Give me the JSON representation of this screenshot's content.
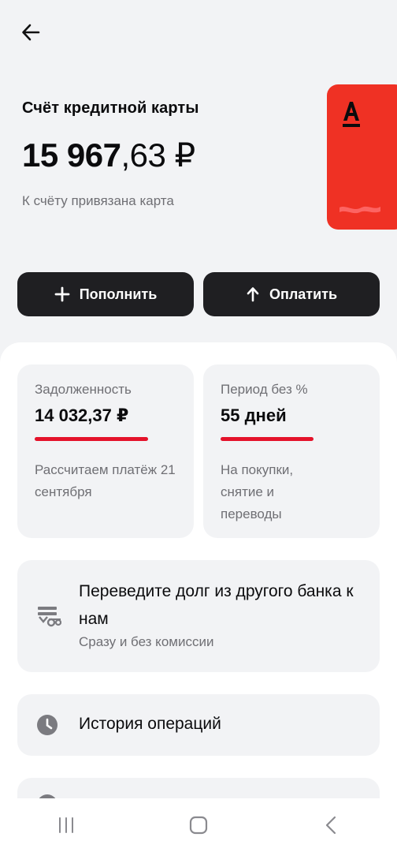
{
  "header": {
    "back_icon": "arrow-left-icon"
  },
  "account": {
    "title": "Счёт кредитной карты",
    "balance_int": "15 967",
    "balance_frac": ",63 ₽",
    "linked_text": "К счёту привязана карта",
    "card_color": "#ef3124",
    "card_logo": "А"
  },
  "actions": {
    "topup_label": "Пополнить",
    "pay_label": "Оплатить"
  },
  "tiles": {
    "debt": {
      "label": "Задолженность",
      "value": "14 032,37 ₽",
      "note": "Рассчитаем платёж 21 сентября"
    },
    "grace": {
      "label": "Период без %",
      "value": "55 дней",
      "note": "На покупки, снятие и переводы"
    }
  },
  "promo": {
    "title": "Переведите долг из другого банка к нам",
    "subtitle": "Сразу и без комиссии",
    "icon": "transfer-debt-icon"
  },
  "history": {
    "label": "История операций",
    "icon": "clock-icon"
  },
  "colors": {
    "accent_red": "#e4122a",
    "button_dark": "#1f1f22",
    "background": "#f2f3f5"
  },
  "navbar": {
    "recents_icon": "recents-icon",
    "home_icon": "home-icon",
    "back_icon": "chevron-left-icon"
  }
}
